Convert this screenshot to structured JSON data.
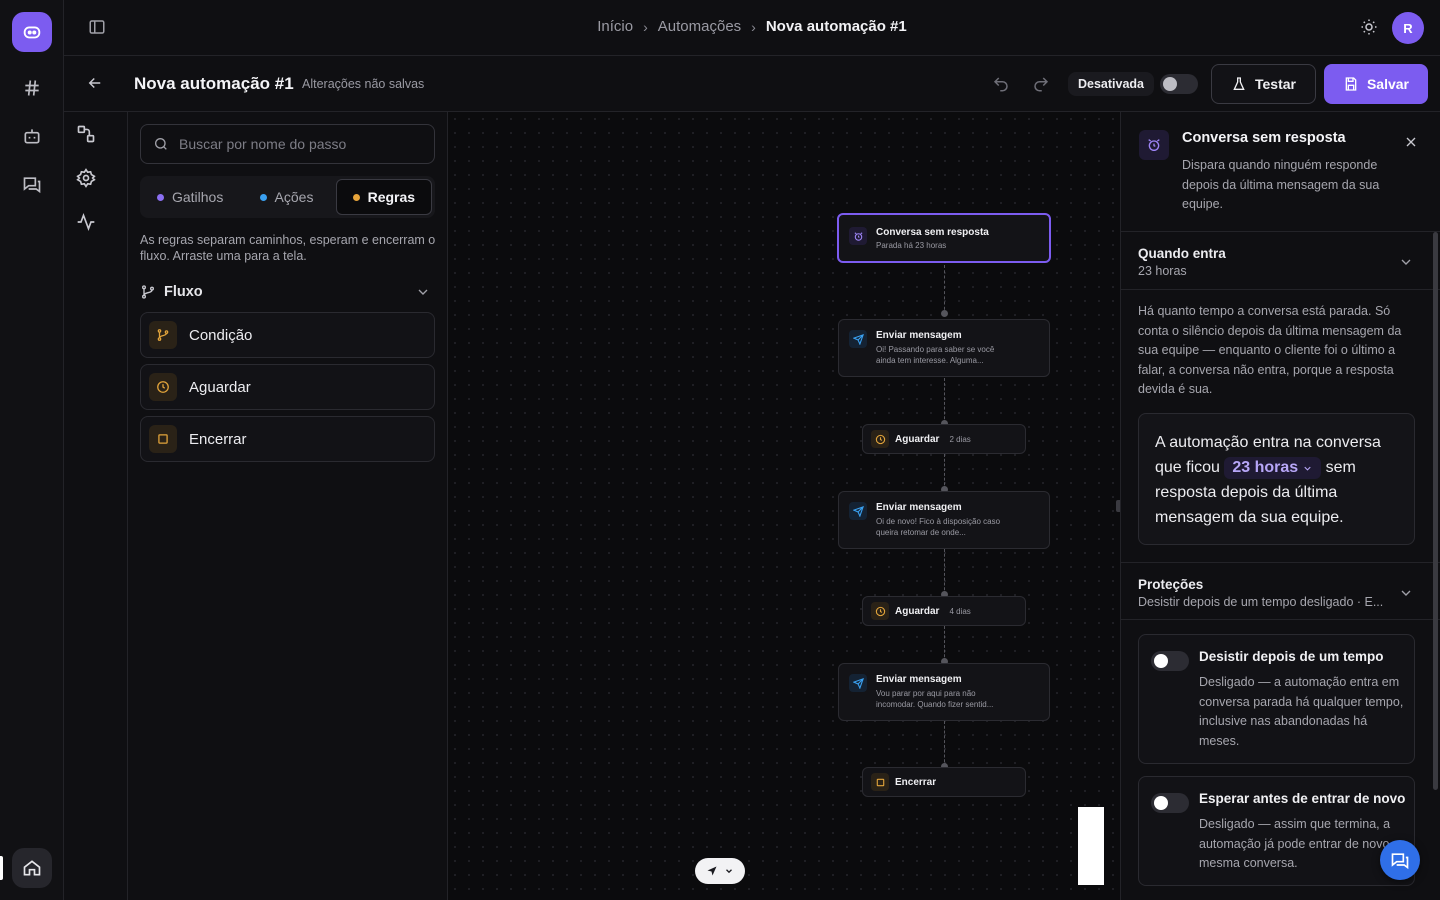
{
  "breadcrumb": {
    "items": [
      "Início",
      "Automações"
    ],
    "current": "Nova automação #1"
  },
  "user": {
    "initial": "R"
  },
  "header": {
    "title": "Nova automação #1",
    "unsaved": "Alterações não salvas",
    "status": "Desativada",
    "status_on": false,
    "test_label": "Testar",
    "save_label": "Salvar"
  },
  "rail": {
    "icons": [
      "bot-logo",
      "hash-icon",
      "robot-icon",
      "chat-icon",
      "home-icon"
    ]
  },
  "panel": {
    "search_placeholder": "Buscar por nome do passo",
    "tabs": [
      {
        "label": "Gatilhos",
        "color": "#8b6ff2"
      },
      {
        "label": "Ações",
        "color": "#3aa0f0"
      },
      {
        "label": "Regras",
        "color": "#e7a43a"
      }
    ],
    "active_tab": "Regras",
    "description": "As regras separam caminhos, esperam e encerram o fluxo. Arraste uma para a tela.",
    "group": {
      "title": "Fluxo",
      "items": [
        {
          "label": "Condição",
          "icon": "branch-icon"
        },
        {
          "label": "Aguardar",
          "icon": "clock-icon"
        },
        {
          "label": "Encerrar",
          "icon": "stop-icon"
        }
      ]
    }
  },
  "flow": {
    "trigger": {
      "title": "Conversa sem resposta",
      "subtitle": "Parada há 23 horas"
    },
    "steps": [
      {
        "type": "message",
        "title": "Enviar mensagem",
        "text": "Oi! Passando para saber se você ainda tem interesse. Alguma..."
      },
      {
        "type": "wait",
        "title": "Aguardar",
        "text": "2 dias"
      },
      {
        "type": "message",
        "title": "Enviar mensagem",
        "text": "Oi de novo! Fico à disposição caso queira retomar de onde..."
      },
      {
        "type": "wait",
        "title": "Aguardar",
        "text": "4 dias"
      },
      {
        "type": "message",
        "title": "Enviar mensagem",
        "text": "Vou parar por aqui para não incomodar. Quando fizer sentid..."
      },
      {
        "type": "end",
        "title": "Encerrar"
      }
    ]
  },
  "details": {
    "title": "Conversa sem resposta",
    "description": "Dispara quando ninguém responde depois da última mensagem da sua equipe.",
    "when": {
      "title": "Quando entra",
      "value": "23 horas",
      "description": "Há quanto tempo a conversa está parada. Só conta o silêncio depois da última mensagem da sua equipe — enquanto o cliente foi o último a falar, a conversa não entra, porque a resposta devida é sua.",
      "sentence_before": "A automação entra na conversa que ficou",
      "sentence_chip": "23 horas",
      "sentence_after": "sem resposta depois da última mensagem da sua equipe."
    },
    "protections": {
      "title": "Proteções",
      "summary": "Desistir depois de um tempo desligado · E...",
      "items": [
        {
          "title": "Desistir depois de um tempo",
          "description": "Desligado — a automação entra em conversa parada há qualquer tempo, inclusive nas abandonadas há meses.",
          "on": false
        },
        {
          "title": "Esperar antes de entrar de novo",
          "description": "Desligado — assim que termina, a automação já pode entrar de novo na mesma conversa.",
          "on": false
        }
      ]
    }
  },
  "colors": {
    "accent": "#7c5cf0",
    "message_icon": "#3aa0f0",
    "rule_icon": "#e2a43b",
    "chat_fab": "#2f6fe8"
  }
}
